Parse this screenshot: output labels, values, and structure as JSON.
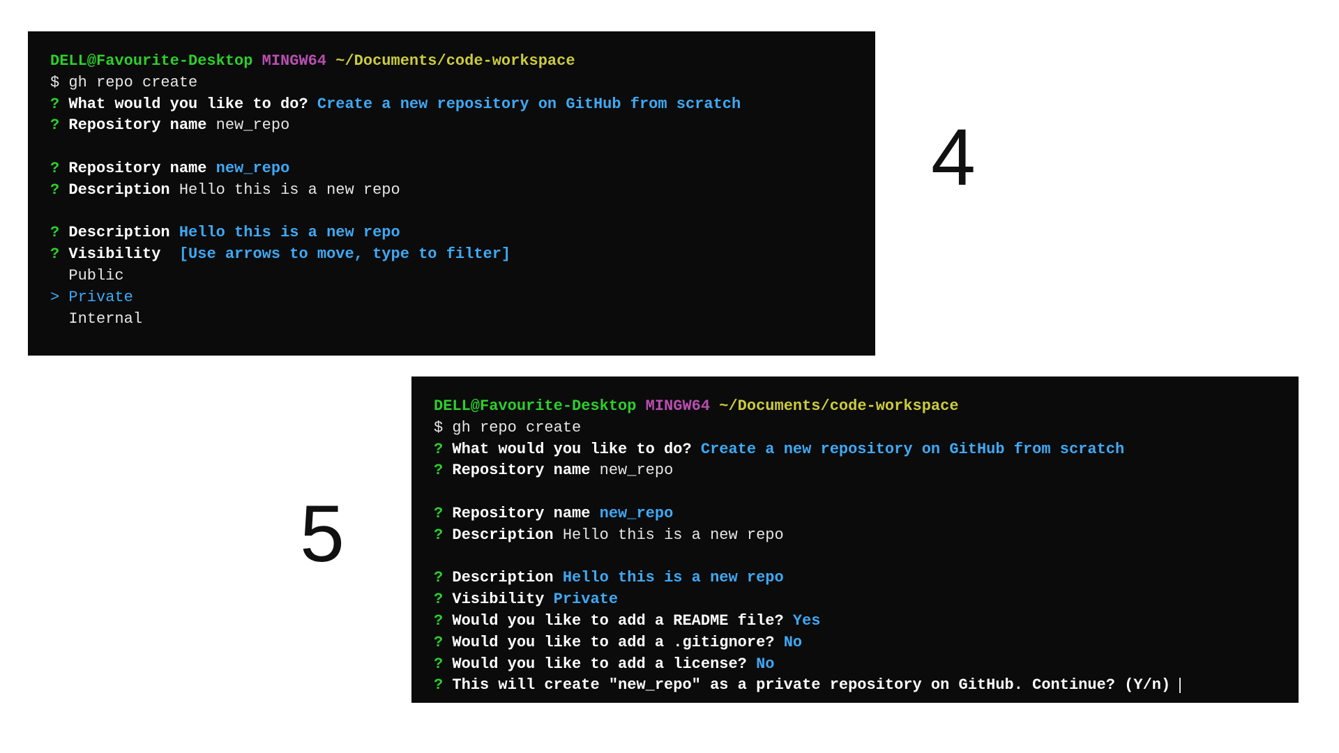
{
  "labels": {
    "step4": "4",
    "step5": "5"
  },
  "prompt": {
    "user": "DELL@Favourite-Desktop",
    "shell": "MINGW64",
    "path": "~/Documents/code-workspace",
    "sym": "$",
    "cmd": "gh repo create"
  },
  "q": {
    "mark": "?",
    "sel": ">",
    "what": "What would you like to do?",
    "what_ans": "Create a new repository on GitHub from scratch",
    "repo": "Repository name",
    "repo_val": "new_repo",
    "desc": "Description",
    "desc_val": "Hello this is a new repo",
    "vis": "Visibility",
    "vis_hint": "[Use arrows to move, type to filter]",
    "vis_public": "Public",
    "vis_private": "Private",
    "vis_internal": "Internal",
    "readme": "Would you like to add a README file?",
    "gitignore": "Would you like to add a .gitignore?",
    "license": "Would you like to add a license?",
    "yes": "Yes",
    "no": "No",
    "confirm": "This will create \"new_repo\" as a private repository on GitHub. Continue? (Y/n)"
  }
}
